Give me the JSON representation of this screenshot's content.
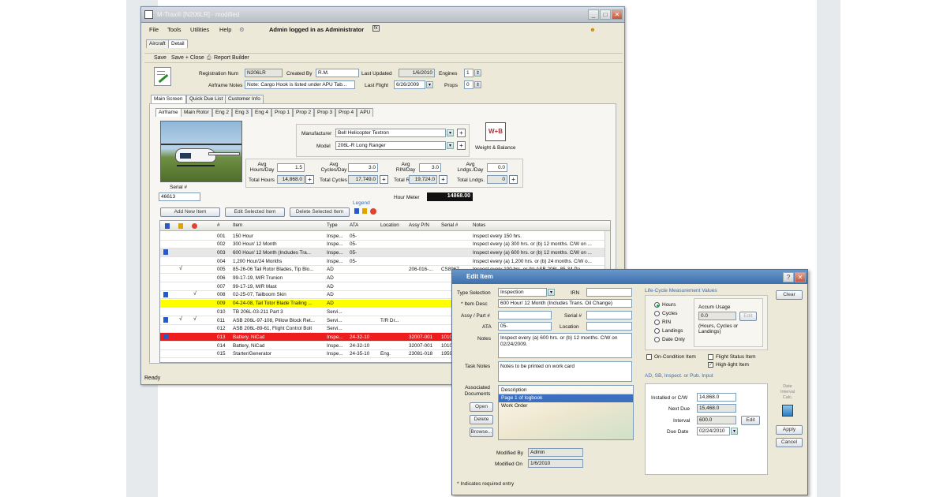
{
  "main_window": {
    "title": "M-Trax® [N206LR] - modified",
    "status": "Ready"
  },
  "menu": {
    "file": "File",
    "tools": "Tools",
    "utilities": "Utilities",
    "help": "Help",
    "admin": "Admin logged in as Administrator"
  },
  "top_tabs": [
    "Aircraft",
    "Detail"
  ],
  "toolbar": {
    "save": "Save",
    "save_close": "Save + Close",
    "report_builder": "Report Builder"
  },
  "header": {
    "registration_label": "Registration Num",
    "registration": "N206LR",
    "created_by_label": "Created By",
    "created_by": "R.M.",
    "last_updated_label": "Last Updated",
    "last_updated": "1/6/2010",
    "engines_label": "Engines",
    "engines": "1",
    "airframe_notes_label": "Airframe Notes",
    "airframe_notes": "Note: Cargo Hook is listed under APU Tab...",
    "last_flight_label": "Last Flight",
    "last_flight": "6/26/2009",
    "props_label": "Props",
    "props": "0"
  },
  "section_tabs": [
    "Main Screen",
    "Quick Due List",
    "Customer Info"
  ],
  "sub_tabs": [
    "Airframe",
    "Main Rotor",
    "Eng 2",
    "Eng 3",
    "Eng 4",
    "Prop 1",
    "Prop 2",
    "Prop 3",
    "Prop 4",
    "APU"
  ],
  "airframe": {
    "manufacturer_label": "Manufacturer",
    "manufacturer": "Bell Helicopter Textron",
    "model_label": "Model",
    "model": "206L-R Long Ranger",
    "weight_balance": "Weight & Balance",
    "serial_label": "Serial #",
    "serial": "46613",
    "hour_meter_label": "Hour Meter",
    "hour_meter": "14868.00"
  },
  "stats": {
    "avg_hours_label": "Avg Hours/Day",
    "avg_hours": "1.5",
    "total_hours_label": "Total Hours",
    "total_hours": "14,868.0",
    "avg_cycles_label": "Avg Cycles/Day",
    "avg_cycles": "3.0",
    "total_cycles_label": "Total Cycles",
    "total_cycles": "17,749.0",
    "avg_rin_label": "Avg RIN/Day",
    "avg_rin": "3.0",
    "total_rin_label": "Total RIN",
    "total_rin": "19,724.0",
    "avg_ldngs_label": "Avg Lndgs./Day",
    "avg_ldngs": "0.0",
    "total_ldngs_label": "Total Lndgs.",
    "total_ldngs": "0"
  },
  "grid_buttons": {
    "add": "Add New Item",
    "edit": "Edit Selected Item",
    "delete": "Delete Selected Item",
    "legend": "Legend"
  },
  "grid": {
    "columns": [
      "#",
      "Item",
      "Type",
      "ATA",
      "Location",
      "Assy P/N",
      "Serial #",
      "Notes"
    ],
    "rows": [
      {
        "num": "001",
        "item": "150 Hour",
        "type": "Inspe...",
        "ata": "05-",
        "loc": "",
        "pn": "",
        "sn": "",
        "notes": "Inspect every 150 hrs.",
        "flag": false,
        "c2": "",
        "c3": "",
        "style": ""
      },
      {
        "num": "002",
        "item": "300 Hour/ 12 Month",
        "type": "Inspe...",
        "ata": "05-",
        "loc": "",
        "pn": "",
        "sn": "",
        "notes": "Inspect every (a) 300 hrs. or (b) 12 months. C/W on ...",
        "flag": false,
        "c2": "",
        "c3": "",
        "style": ""
      },
      {
        "num": "003",
        "item": "600 Hour/ 12 Month (Includes Tra...",
        "type": "Inspe...",
        "ata": "05-",
        "loc": "",
        "pn": "",
        "sn": "",
        "notes": "Inspect every (a) 600 hrs. or (b) 12 months. C/W on ...",
        "flag": true,
        "c2": "",
        "c3": "",
        "style": "gray"
      },
      {
        "num": "004",
        "item": "1,200 Hour/24 Months",
        "type": "Inspe...",
        "ata": "05-",
        "loc": "",
        "pn": "",
        "sn": "",
        "notes": "Inspect every (a) 1,200 hrs. or (b) 24 months. C/W o...",
        "flag": false,
        "c2": "",
        "c3": "",
        "style": ""
      },
      {
        "num": "005",
        "item": "85-26-06 Tail Rotor Blades, Tip Blo...",
        "type": "AD",
        "ata": "",
        "loc": "",
        "pn": "206-016-...",
        "sn": "CS8967...",
        "notes": "Inspect every 100 hrs. or (b) ASB 206L-85-34 Pa...",
        "flag": false,
        "c2": "√",
        "c3": "",
        "style": ""
      },
      {
        "num": "006",
        "item": "99-17-19, M/R Trunion",
        "type": "AD",
        "ata": "",
        "loc": "",
        "pn": "",
        "sn": "",
        "notes": "",
        "flag": false,
        "c2": "",
        "c3": "",
        "style": ""
      },
      {
        "num": "007",
        "item": "99-17-19, M/R Mast",
        "type": "AD",
        "ata": "",
        "loc": "",
        "pn": "",
        "sn": "",
        "notes": "",
        "flag": false,
        "c2": "",
        "c3": "",
        "style": ""
      },
      {
        "num": "008",
        "item": "02-25-07, Tailboom Skin",
        "type": "AD",
        "ata": "",
        "loc": "",
        "pn": "",
        "sn": "",
        "notes": "",
        "flag": true,
        "c2": "",
        "c3": "√",
        "style": ""
      },
      {
        "num": "009",
        "item": "04-24-08, Tail Totor Blade Trailing ...",
        "type": "AD",
        "ata": "",
        "loc": "",
        "pn": "",
        "sn": "",
        "notes": "",
        "flag": false,
        "c2": "",
        "c3": "",
        "style": "yellow"
      },
      {
        "num": "010",
        "item": "TB 206L-03-211 Part 3",
        "type": "Servi...",
        "ata": "",
        "loc": "",
        "pn": "",
        "sn": "",
        "notes": "",
        "flag": false,
        "c2": "",
        "c3": "",
        "style": ""
      },
      {
        "num": "011",
        "item": "ASB 206L-97-108, Pillow Block Ret...",
        "type": "Servi...",
        "ata": "",
        "loc": "T/R Dr...",
        "pn": "",
        "sn": "",
        "notes": "",
        "flag": true,
        "c2": "√",
        "c3": "√",
        "style": ""
      },
      {
        "num": "012",
        "item": "ASB 206L-89-61, Flight Control Bolt",
        "type": "Servi...",
        "ata": "",
        "loc": "",
        "pn": "",
        "sn": "",
        "notes": "",
        "flag": false,
        "c2": "",
        "c3": "",
        "style": ""
      },
      {
        "num": "013",
        "item": "Battery, NiCad",
        "type": "Inspe...",
        "ata": "24-32-10",
        "loc": "",
        "pn": "32007-001",
        "sn": "1010",
        "notes": "",
        "flag": true,
        "c2": "",
        "c3": "",
        "style": "red"
      },
      {
        "num": "014",
        "item": "Battery, NiCad",
        "type": "Inspe...",
        "ata": "24-32-10",
        "loc": "",
        "pn": "32007-001",
        "sn": "1010",
        "notes": "",
        "flag": false,
        "c2": "",
        "c3": "",
        "style": ""
      },
      {
        "num": "015",
        "item": "Starter/Generator",
        "type": "Inspe...",
        "ata": "24-35-10",
        "loc": "Eng.",
        "pn": "23081-018",
        "sn": "1959",
        "notes": "",
        "flag": false,
        "c2": "",
        "c3": "",
        "style": ""
      }
    ]
  },
  "edit_dialog": {
    "title": "Edit Item",
    "type_selection_label": "Type Selection",
    "type_selection": "Inspection",
    "irn_label": "IRN",
    "irn": "",
    "item_desc_label": "* Item Desc",
    "item_desc": "600 Hour/ 12 Month (Includes Trans. Oil Change)",
    "assy_part_label": "Assy / Part #",
    "serial_label": "Serial #",
    "ata_label": "ATA",
    "ata": "05-",
    "location_label": "Location",
    "notes_label": "Notes",
    "notes": "Inspect every (a) 600 hrs. or (b) 12 months. C/W on 02/24/2009.",
    "task_notes_label": "Task Notes",
    "task_notes": "Notes to be printed on work card",
    "assoc_docs_label": "Associated Documents",
    "docs_header": "Description",
    "docs": [
      "Page 1 of logbook",
      "Work Order"
    ],
    "open": "Open",
    "delete": "Delete",
    "browse": "Browse...",
    "modified_by_label": "Modified By",
    "modified_by": "Admin",
    "modified_on_label": "Modified On",
    "modified_on": "1/6/2010",
    "required_note": "* Indicates required entry",
    "lifecycle_title": "Life-Cycle Measurement Values",
    "radios": [
      "Hours",
      "Cycles",
      "RIN",
      "Landings",
      "Date Only"
    ],
    "accum_usage_label": "Accum Usage",
    "accum_usage": "0.0",
    "accum_edit": "Edit",
    "accum_hint": "(Hours, Cycles or Landings)",
    "on_condition": "On-Condition Item",
    "flight_status": "Flight Status Item",
    "highlight": "High-light Item",
    "ad_sb_title": "AD, SB, Inspect. or Pub. Input",
    "installed_label": "Installed or C/W",
    "installed": "14,868.0",
    "next_due_label": "Next Due",
    "next_due": "15,468.0",
    "interval_label": "Interval",
    "interval": "600.0",
    "interval_edit": "Edit",
    "due_date_label": "Due Date",
    "due_date": "02/24/2010",
    "date_calc": "Date Interval Calc.",
    "clear": "Clear",
    "apply": "Apply",
    "cancel": "Cancel"
  },
  "colors": {
    "highlight_yellow": "#ffff00",
    "highlight_red": "#ee1c1c",
    "title_blue": "#3c6fae"
  }
}
